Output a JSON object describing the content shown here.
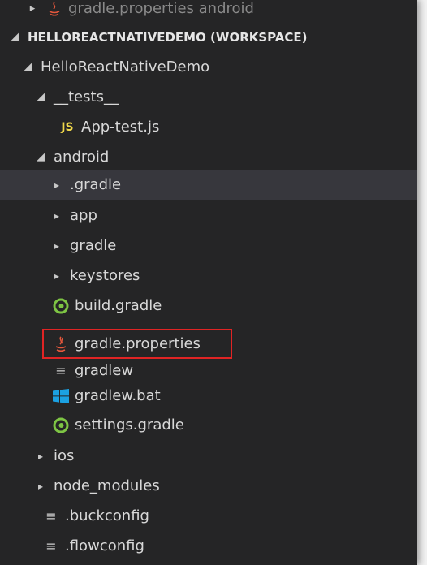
{
  "partial_top_item": "gradle.properties android",
  "workspace_header": "HELLOREACTNATIVEDEMO (WORKSPACE)",
  "tree": {
    "project": "HelloReactNativeDemo",
    "tests_folder": "__tests__",
    "app_test": "App-test.js",
    "android_folder": "android",
    "android_children": {
      "dot_gradle": ".gradle",
      "app": "app",
      "gradle": "gradle",
      "keystores": "keystores",
      "build_gradle": "build.gradle",
      "gradle_properties": "gradle.properties",
      "gradlew": "gradlew",
      "gradlew_bat": "gradlew.bat",
      "settings_gradle": "settings.gradle"
    },
    "ios": "ios",
    "node_modules": "node_modules",
    "buckconfig": ".buckconfig",
    "flowconfig": ".flowconfig"
  },
  "icons": {
    "js": "JS",
    "colors": {
      "gradle": "#7ec544",
      "java": "#e4573c",
      "windows": "#1ba1e2",
      "js": "#f0d84a",
      "highlight_box": "#e02424"
    }
  }
}
